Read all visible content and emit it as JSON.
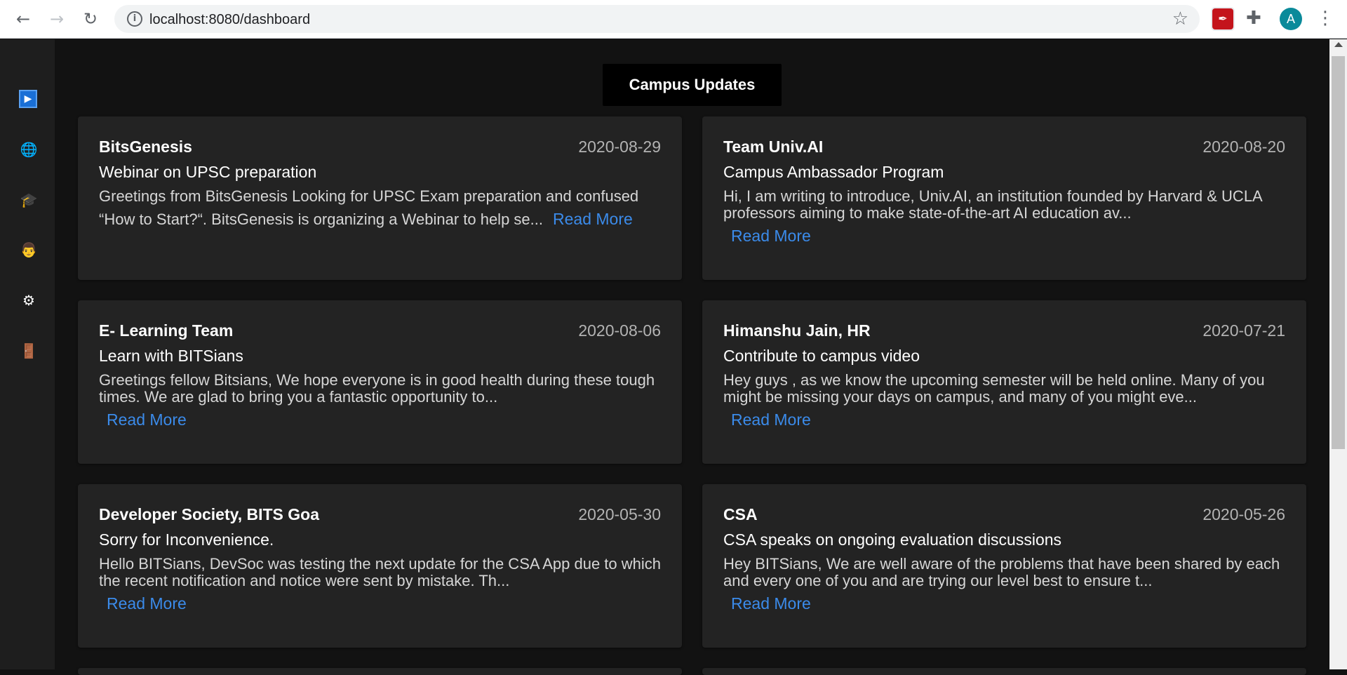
{
  "browser": {
    "back_icon": "←",
    "forward_icon": "→",
    "reload_icon": "↻",
    "info_icon": "i",
    "url": "localhost:8080/dashboard",
    "star_icon": "☆",
    "pdf_icon": "✒",
    "puzzle_icon": "✚",
    "avatar_letter": "A",
    "menu_icon": "⋮"
  },
  "sidebar": {
    "icons": [
      {
        "name": "play-icon",
        "glyph": "▶"
      },
      {
        "name": "globe-icon",
        "glyph": "🌐"
      },
      {
        "name": "graduation-cap-icon",
        "glyph": "🎓"
      },
      {
        "name": "person-icon",
        "glyph": "👨"
      },
      {
        "name": "gear-icon",
        "glyph": "⚙"
      },
      {
        "name": "door-icon",
        "glyph": "🚪"
      }
    ]
  },
  "page": {
    "title": "Campus Updates"
  },
  "cards": [
    {
      "sender": "BitsGenesis",
      "date": "2020-08-29",
      "subject": "Webinar on UPSC preparation",
      "body": "Greetings from BitsGenesis Looking for UPSC Exam preparation and confused “How to Start?“. BitsGenesis is organizing a  Webinar to help se...",
      "read_more": "Read More"
    },
    {
      "sender": "Team Univ.AI",
      "date": "2020-08-20",
      "subject": "Campus Ambassador Program",
      "body": "Hi, I am writing to introduce, Univ.AI, an institution founded by Harvard & UCLA professors aiming to make state-of-the-art AI education av...",
      "read_more": "Read More"
    },
    {
      "sender": "E- Learning Team",
      "date": "2020-08-06",
      "subject": "Learn with BITSians",
      "body": "Greetings fellow Bitsians, We hope everyone is in good health during these tough times. We are glad to bring you a fantastic opportunity to...",
      "read_more": "Read More"
    },
    {
      "sender": "Himanshu Jain, HR",
      "date": "2020-07-21",
      "subject": "Contribute to campus video",
      "body": "Hey guys , as we know the upcoming semester will be held online. Many of you might be missing your days on campus, and many of you might eve...",
      "read_more": "Read More"
    },
    {
      "sender": "Developer Society, BITS Goa",
      "date": "2020-05-30",
      "subject": "Sorry for Inconvenience.",
      "body": "Hello BITSians, DevSoc was testing the next update for the CSA App due to which the recent notification and notice were sent by mistake. Th...",
      "read_more": "Read More"
    },
    {
      "sender": "CSA",
      "date": "2020-05-26",
      "subject": "CSA speaks on ongoing evaluation discussions",
      "body": "Hey BITSians, We are well aware of the problems that have been shared by each and every one of you and are trying our level best to ensure t...",
      "read_more": "Read More"
    }
  ]
}
